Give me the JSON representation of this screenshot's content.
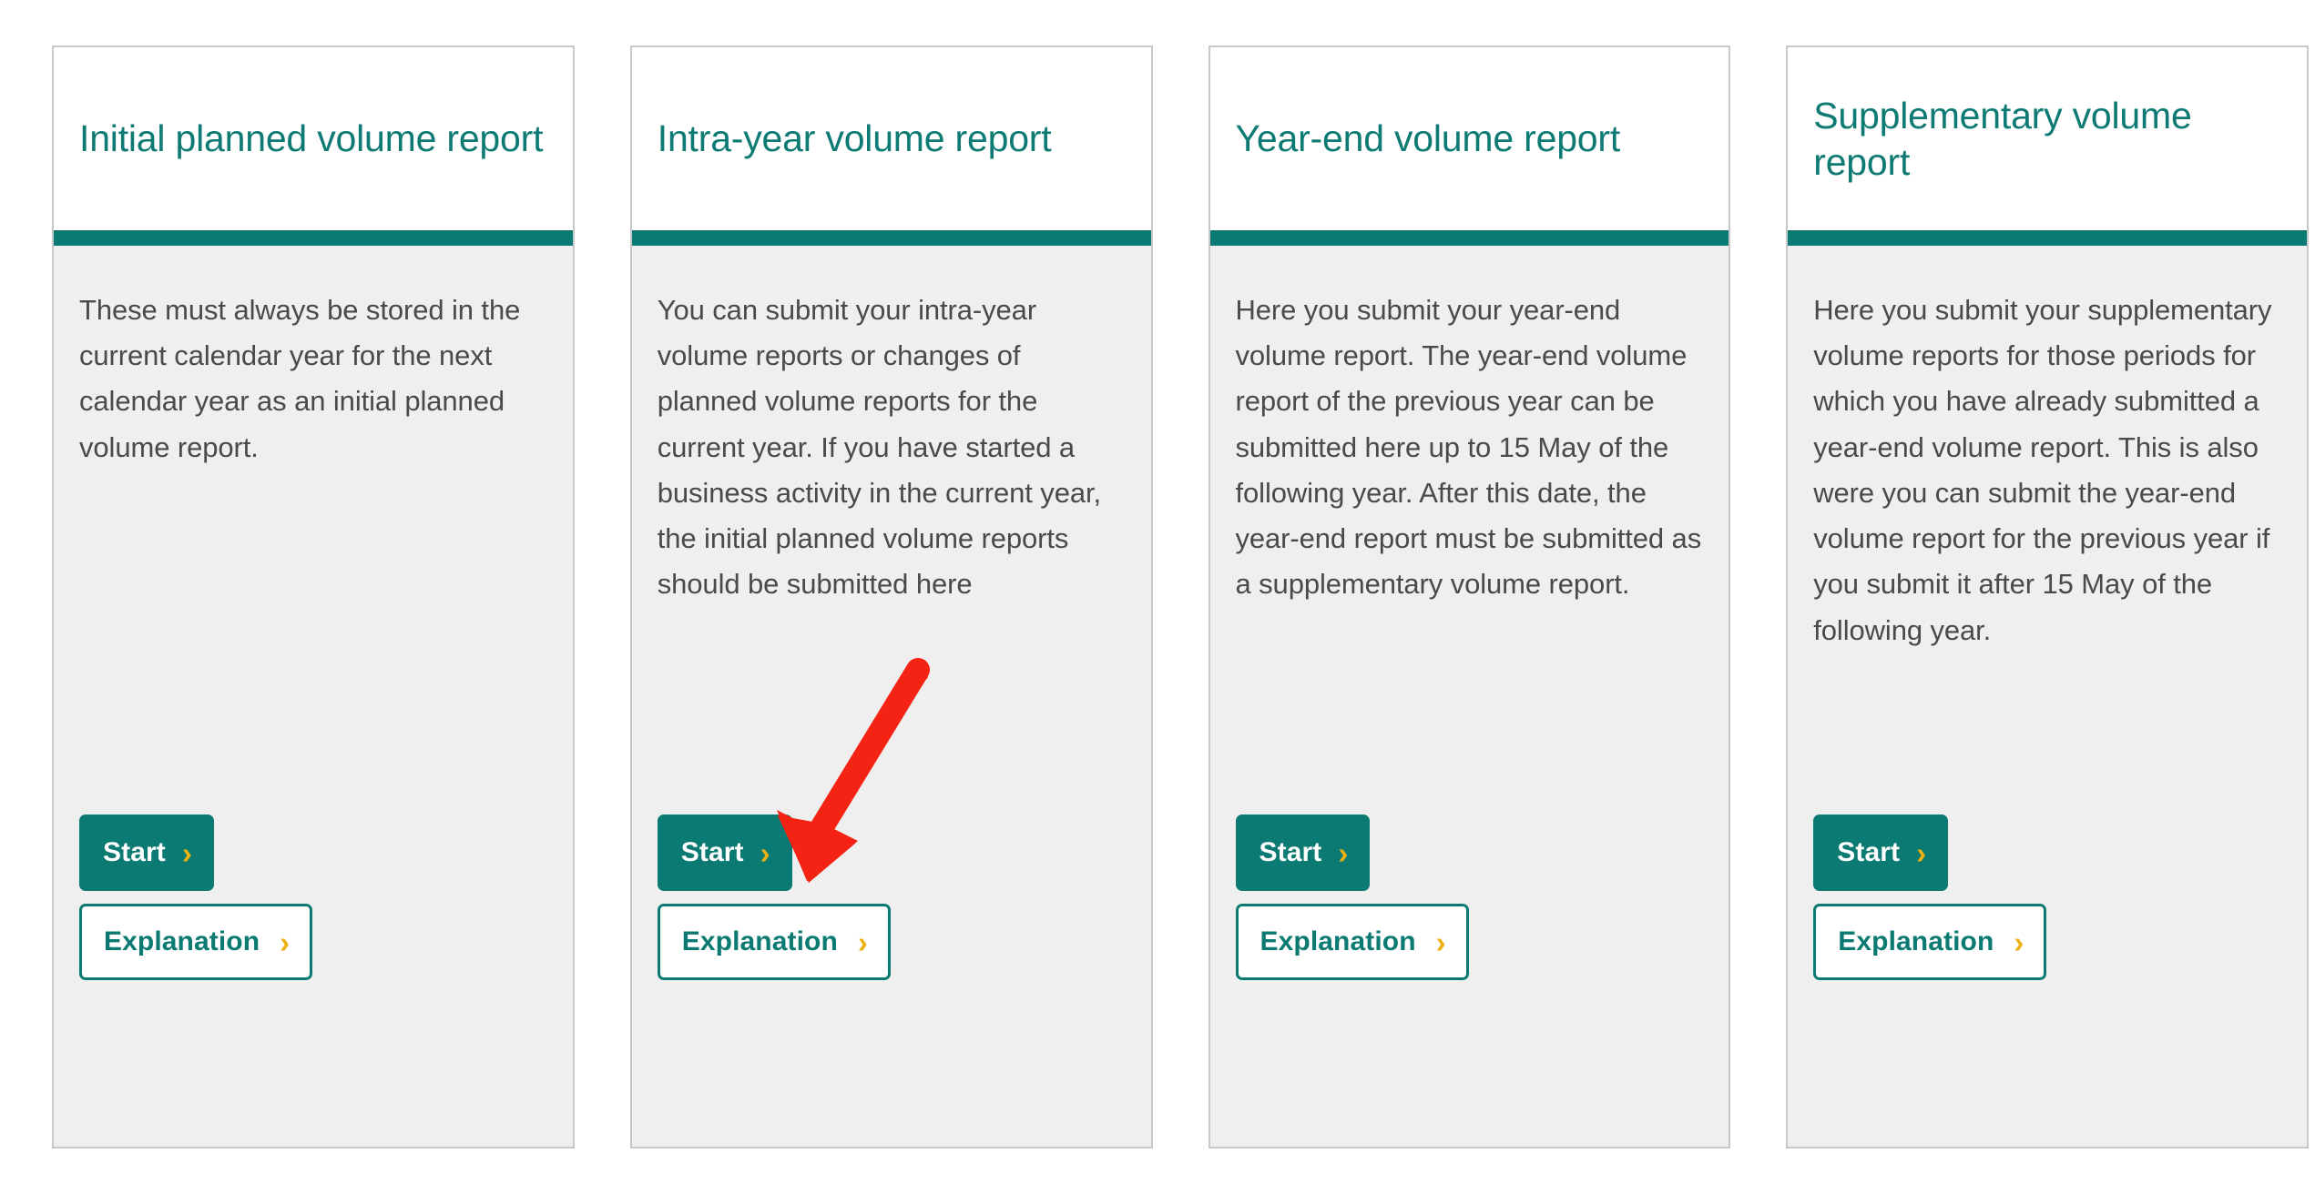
{
  "page": {
    "background_color": "#ffffff",
    "accent_color": "#0b7a72",
    "card_border_color": "#c8c8c8",
    "card_body_color": "#efefef",
    "body_text_color": "#4a4a4a",
    "chevron_color": "#eeb111",
    "annotation_color": "#f52314"
  },
  "cards": [
    {
      "title": "Initial planned volume report",
      "body": "These must always be stored in the current calendar year for the next calendar year as an initial planned volume report.",
      "start_label": "Start",
      "explanation_label": "Explanation",
      "chevron": "›"
    },
    {
      "title": "Intra-year volume report",
      "body": "You can submit your intra-year volume reports or changes of planned volume reports for the current year. If you have started a business activity in the current year, the initial planned volume reports should be submitted here",
      "start_label": "Start",
      "explanation_label": "Explanation",
      "chevron": "›"
    },
    {
      "title": "Year-end volume report",
      "body": "Here you submit your year-end volume report. The year-end volume report of the previous year can be submitted here up to 15 May of the following year. After this date, the year-end report must be submitted as a supplementary volume report.",
      "start_label": "Start",
      "explanation_label": "Explanation",
      "chevron": "›"
    },
    {
      "title": "Supplementary volume report",
      "body": "Here you submit your supplementary volume reports for those periods for which you have already submitted a year-end volume report. This is also were you can submit the year-end volume report for the previous year if you submit it after 15 May of the following year.",
      "start_label": "Start",
      "explanation_label": "Explanation",
      "chevron": "›"
    }
  ],
  "annotation": {
    "type": "arrow",
    "points_to": "intra-year-start-button",
    "color": "#f52314"
  }
}
